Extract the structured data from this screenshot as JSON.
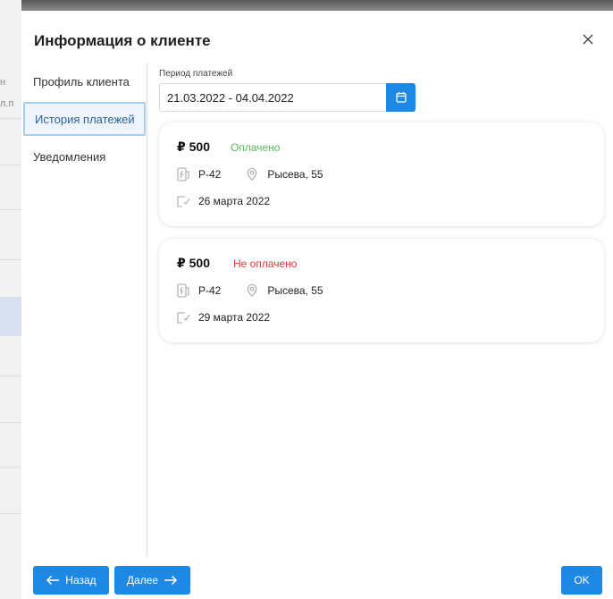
{
  "background": {
    "fragments": [
      "н",
      "л.п"
    ]
  },
  "dialog": {
    "title": "Информация о клиенте"
  },
  "nav": {
    "items": [
      {
        "label": "Профиль клиента"
      },
      {
        "label": "История платежей"
      },
      {
        "label": "Уведомления"
      }
    ],
    "active_index": 1
  },
  "filter": {
    "label": "Период платежей",
    "value": "21.03.2022 - 04.04.2022"
  },
  "payments": [
    {
      "amount": "₽ 500",
      "status": "Оплачено",
      "status_color": "#5cb85c",
      "station": "P-42",
      "address": "Рысева, 55",
      "date": "26 марта 2022"
    },
    {
      "amount": "₽ 500",
      "status": "Не оплачено",
      "status_color": "#e53935",
      "station": "P-42",
      "address": "Рысева, 55",
      "date": "29 марта 2022"
    }
  ],
  "footer": {
    "back_label": "Назад",
    "next_label": "Далее",
    "ok_label": "OK"
  },
  "colors": {
    "accent": "#1e88e5",
    "icon_gray": "#a8a8a8"
  }
}
